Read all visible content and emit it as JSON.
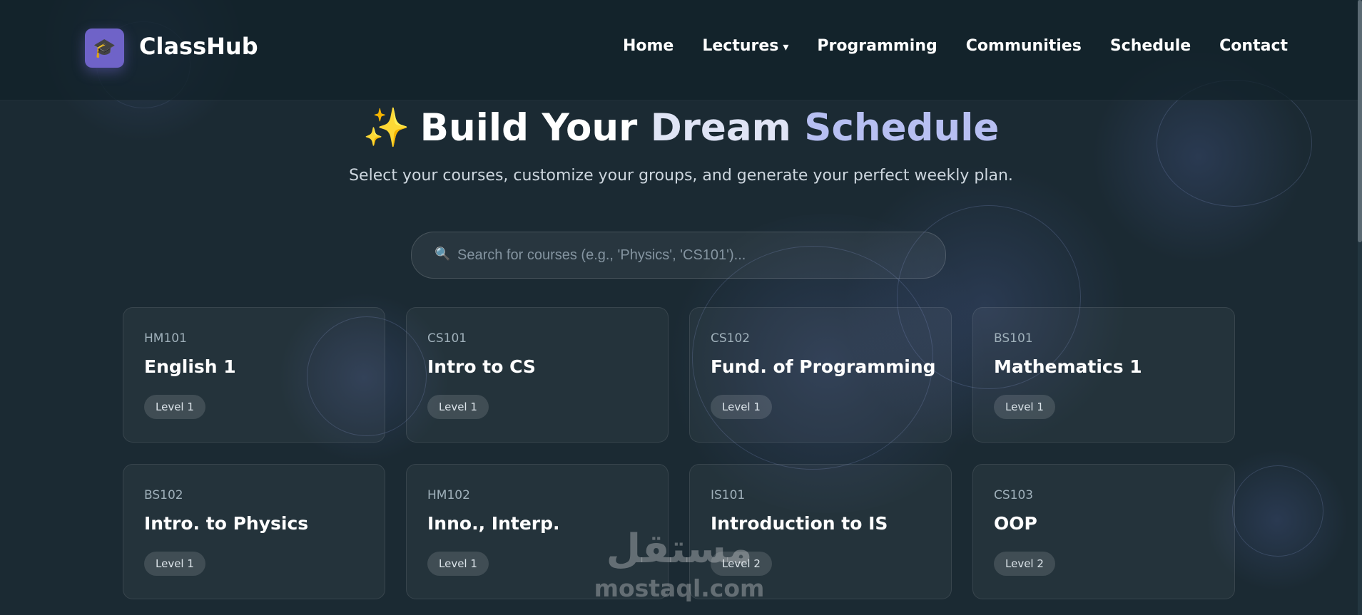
{
  "brand": {
    "name": "ClassHub",
    "logo_icon": "graduation-cap-icon",
    "logo_glyph": "🎓",
    "accent": "#6f63c8"
  },
  "nav": {
    "items": [
      {
        "label": "Home"
      },
      {
        "label": "Lectures",
        "caret": "▾"
      },
      {
        "label": "Programming"
      },
      {
        "label": "Communities"
      },
      {
        "label": "Schedule"
      },
      {
        "label": "Contact"
      }
    ]
  },
  "hero": {
    "sparkle": "✨",
    "title_part1": "Build Your",
    "title_part2": "Dream",
    "title_part3": "Schedule",
    "subtitle": "Select your courses, customize your groups, and generate your perfect weekly plan."
  },
  "search": {
    "icon": "🔍",
    "placeholder": "Search for courses (e.g., 'Physics', 'CS101')..."
  },
  "courses": [
    {
      "code": "HM101",
      "title": "English 1",
      "level": "Level 1"
    },
    {
      "code": "CS101",
      "title": "Intro to CS",
      "level": "Level 1"
    },
    {
      "code": "CS102",
      "title": "Fund. of Programming",
      "level": "Level 1"
    },
    {
      "code": "BS101",
      "title": "Mathematics 1",
      "level": "Level 1"
    },
    {
      "code": "BS102",
      "title": "Intro. to Physics",
      "level": "Level 1"
    },
    {
      "code": "HM102",
      "title": "Inno., Interp.",
      "level": "Level 1"
    },
    {
      "code": "IS101",
      "title": "Introduction to IS",
      "level": "Level 2"
    },
    {
      "code": "CS103",
      "title": "OOP",
      "level": "Level 2"
    }
  ],
  "watermark": {
    "arabic": "مستقل",
    "latin": "mostaql.com"
  },
  "colors": {
    "background": "#1b2a33",
    "title_accent": "#b7bff2",
    "sparkle": "#f4b731"
  }
}
